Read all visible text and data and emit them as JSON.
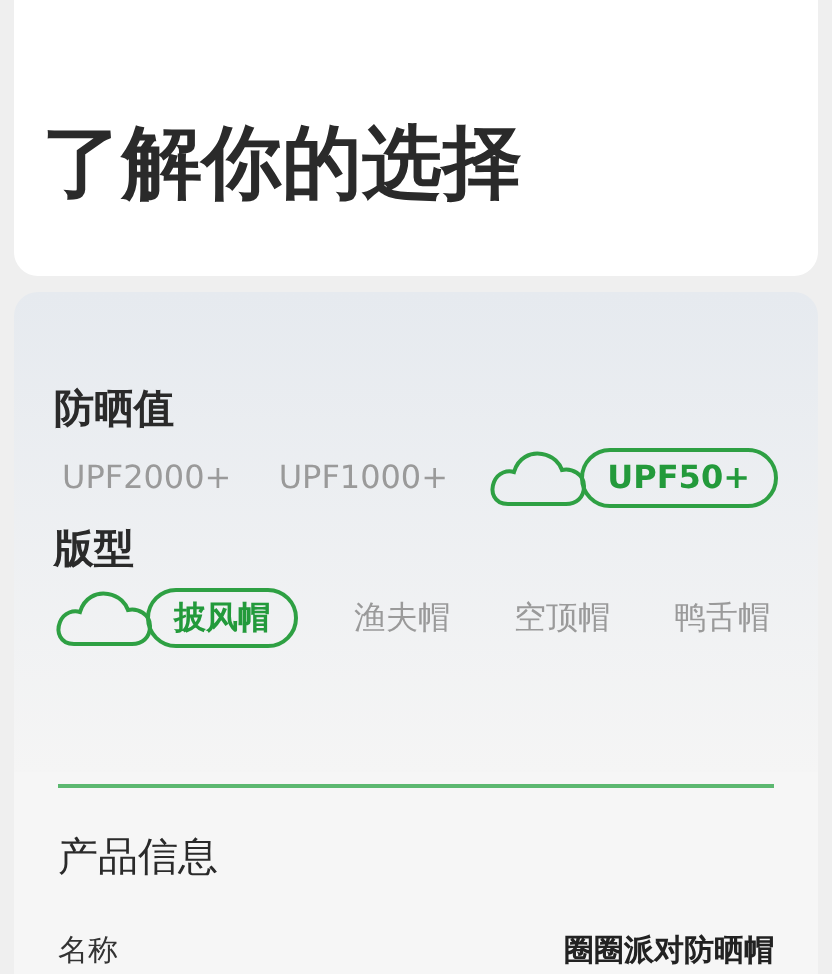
{
  "title": "了解你的选择",
  "groups": [
    {
      "label": "防晒值",
      "options": [
        {
          "label": "UPF2000+",
          "selected": false
        },
        {
          "label": "UPF1000+",
          "selected": false
        },
        {
          "label": "UPF50+",
          "selected": true
        }
      ]
    },
    {
      "label": "版型",
      "options": [
        {
          "label": "披风帽",
          "selected": true
        },
        {
          "label": "渔夫帽",
          "selected": false
        },
        {
          "label": "空顶帽",
          "selected": false
        },
        {
          "label": "鸭舌帽",
          "selected": false
        }
      ]
    }
  ],
  "info": {
    "heading": "产品信息",
    "rows": [
      {
        "label": "名称",
        "value": "圈圈派对防晒帽"
      }
    ]
  }
}
